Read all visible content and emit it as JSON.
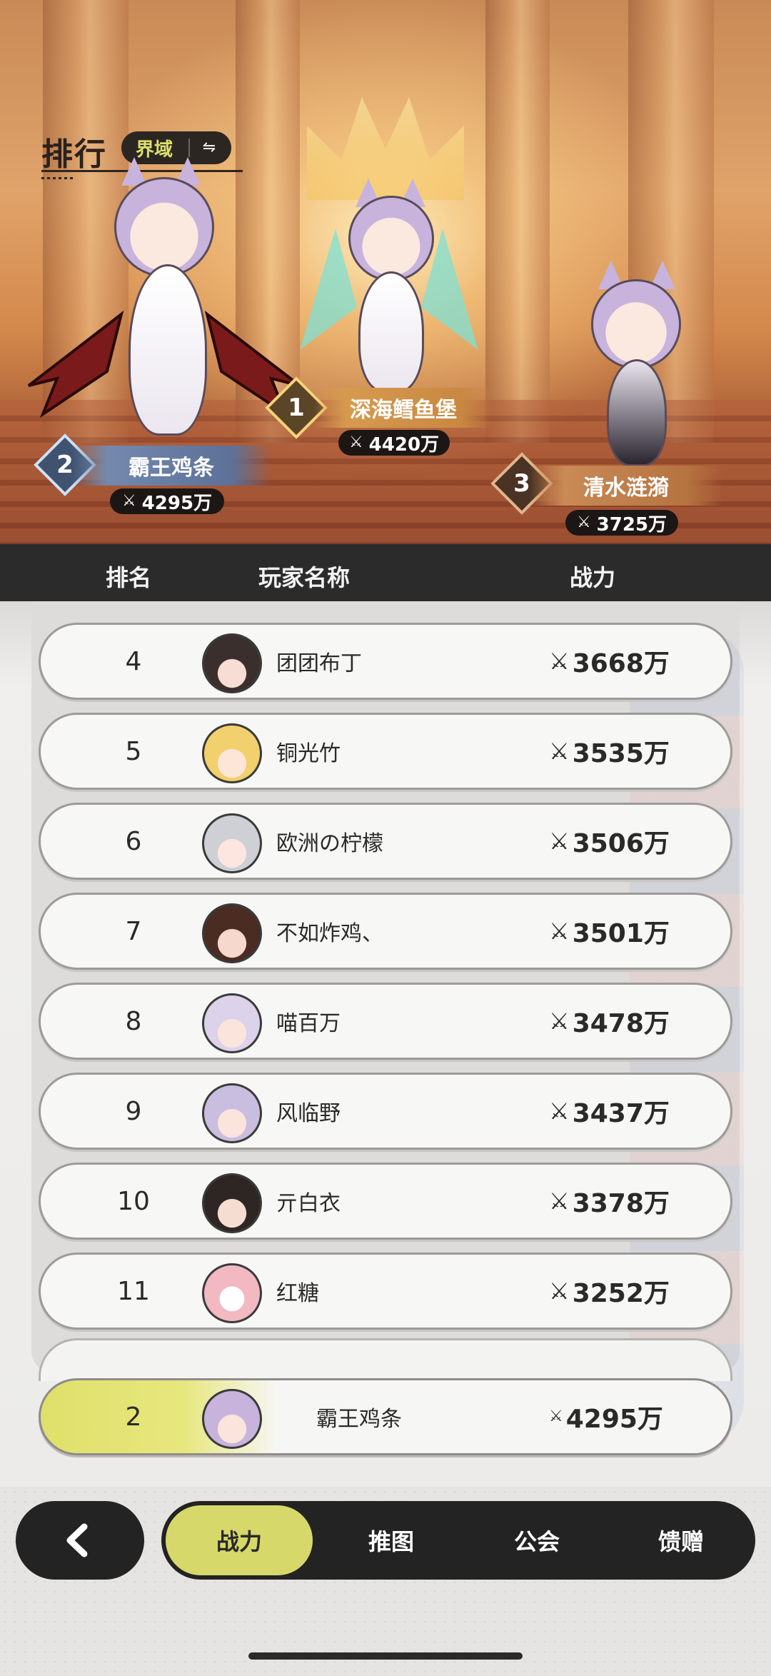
{
  "header": {
    "title": "排行",
    "realm_label": "界域",
    "swap_icon": "swap-arrows-icon"
  },
  "podium": {
    "first": {
      "rank": "1",
      "name": "深海鳕鱼堡",
      "power": "4420万"
    },
    "second": {
      "rank": "2",
      "name": "霸王鸡条",
      "power": "4295万"
    },
    "third": {
      "rank": "3",
      "name": "清水涟漪",
      "power": "3725万"
    }
  },
  "table": {
    "col_rank": "排名",
    "col_name": "玩家名称",
    "col_power": "战力",
    "rows": [
      {
        "rank": "4",
        "name": "团团布丁",
        "power": "3668万"
      },
      {
        "rank": "5",
        "name": "铜光竹",
        "power": "3535万"
      },
      {
        "rank": "6",
        "name": "欧洲の柠檬",
        "power": "3506万"
      },
      {
        "rank": "7",
        "name": "不如炸鸡、",
        "power": "3501万"
      },
      {
        "rank": "8",
        "name": "喵百万",
        "power": "3478万"
      },
      {
        "rank": "9",
        "name": "风临野",
        "power": "3437万"
      },
      {
        "rank": "10",
        "name": "亓白衣",
        "power": "3378万"
      },
      {
        "rank": "11",
        "name": "红糖",
        "power": "3252万"
      }
    ]
  },
  "self": {
    "rank": "2",
    "name": "霸王鸡条",
    "power": "4295万"
  },
  "tabs": [
    {
      "label": "战力",
      "active": true
    },
    {
      "label": "推图",
      "active": false
    },
    {
      "label": "公会",
      "active": false
    },
    {
      "label": "馈赠",
      "active": false
    }
  ],
  "colors": {
    "accent": "#d7d86a",
    "dark": "#232323"
  }
}
